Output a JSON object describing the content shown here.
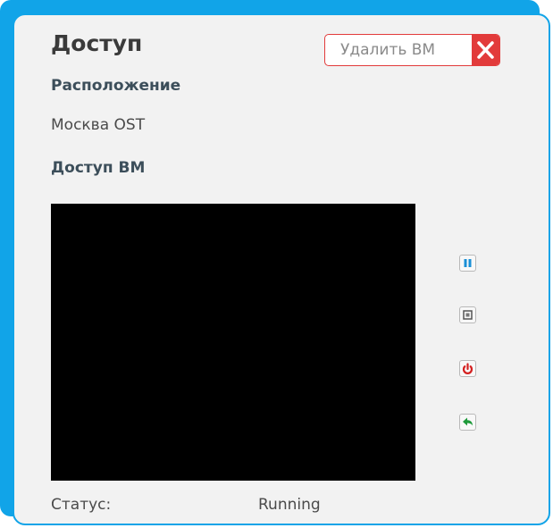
{
  "panel": {
    "title": "Доступ",
    "delete_button_label": "Удалить ВМ",
    "location_label": "Расположение",
    "location_value": "Москва OST",
    "vm_access_label": "Доступ ВМ",
    "status_label": "Статус:",
    "status_value": "Running"
  },
  "controls": [
    {
      "icon": "pause-icon"
    },
    {
      "icon": "stop-icon"
    },
    {
      "icon": "power-icon"
    },
    {
      "icon": "back-arrow-icon"
    }
  ],
  "colors": {
    "accent_blue": "#11a4e8",
    "danger_red": "#e23b3b",
    "panel_bg": "#f2f2f2",
    "console_bg": "#000000"
  }
}
